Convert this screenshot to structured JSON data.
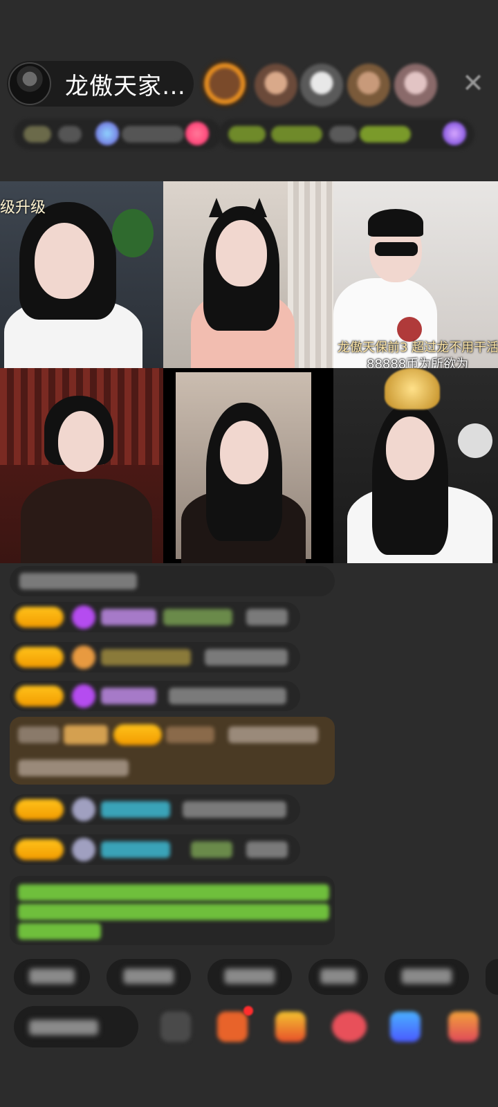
{
  "header": {
    "host_name": "龙傲天家…"
  },
  "grid": {
    "tile1_banner": "级升级",
    "tile3_caption_line1": "龙傲天保前3 超过龙不用干活",
    "tile3_caption_line2": "88888币为所欲为"
  },
  "colors": {
    "background": "#2c2c2c",
    "level_badge": "#ffc21a",
    "gem_purple": "#b54cf0",
    "name_teal": "#3aa3b8",
    "name_green": "#7ab04a",
    "notice_green": "#6fbf3c"
  }
}
